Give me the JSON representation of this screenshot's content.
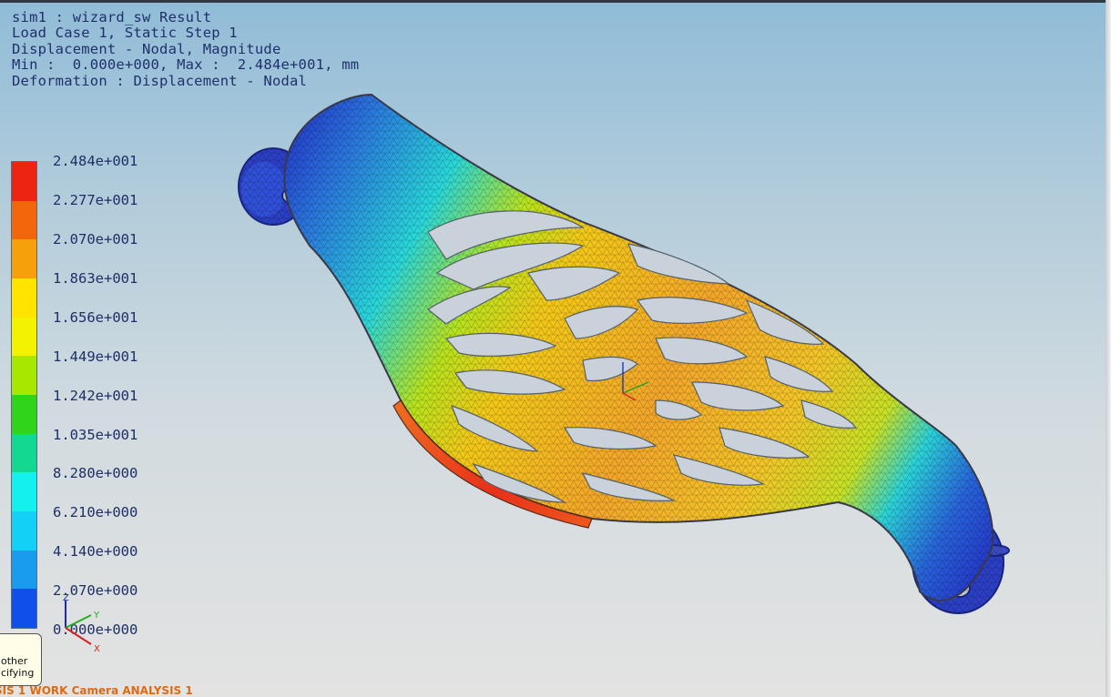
{
  "header": {
    "lines": [
      "sim1 : wizard_sw Result",
      "Load Case 1, Static Step 1",
      "Displacement - Nodal, Magnitude",
      "Min :  0.000e+000, Max :  2.484e+001, mm",
      "Deformation : Displacement - Nodal"
    ]
  },
  "legend": {
    "labels": [
      "2.484e+001",
      "2.277e+001",
      "2.070e+001",
      "1.863e+001",
      "1.656e+001",
      "1.449e+001",
      "1.242e+001",
      "1.035e+001",
      "8.280e+000",
      "6.210e+000",
      "4.140e+000",
      "2.070e+000",
      "0.000e+000"
    ],
    "colors": [
      "#ee2412",
      "#f2660c",
      "#f6a00b",
      "#ffe400",
      "#f3f200",
      "#a6e800",
      "#30d41a",
      "#12d892",
      "#14f0ee",
      "#12d0f6",
      "#1a9cee",
      "#1050e8"
    ]
  },
  "triad": {
    "z": "Z",
    "y": "Y",
    "x": "X"
  },
  "tooltip": {
    "line1": "other",
    "line2": "cifying"
  },
  "status": {
    "text": "SIS 1 WORK Camera ANALYSIS 1"
  },
  "colors": {
    "header_text": "#20306a",
    "status_text": "#e06a10"
  }
}
